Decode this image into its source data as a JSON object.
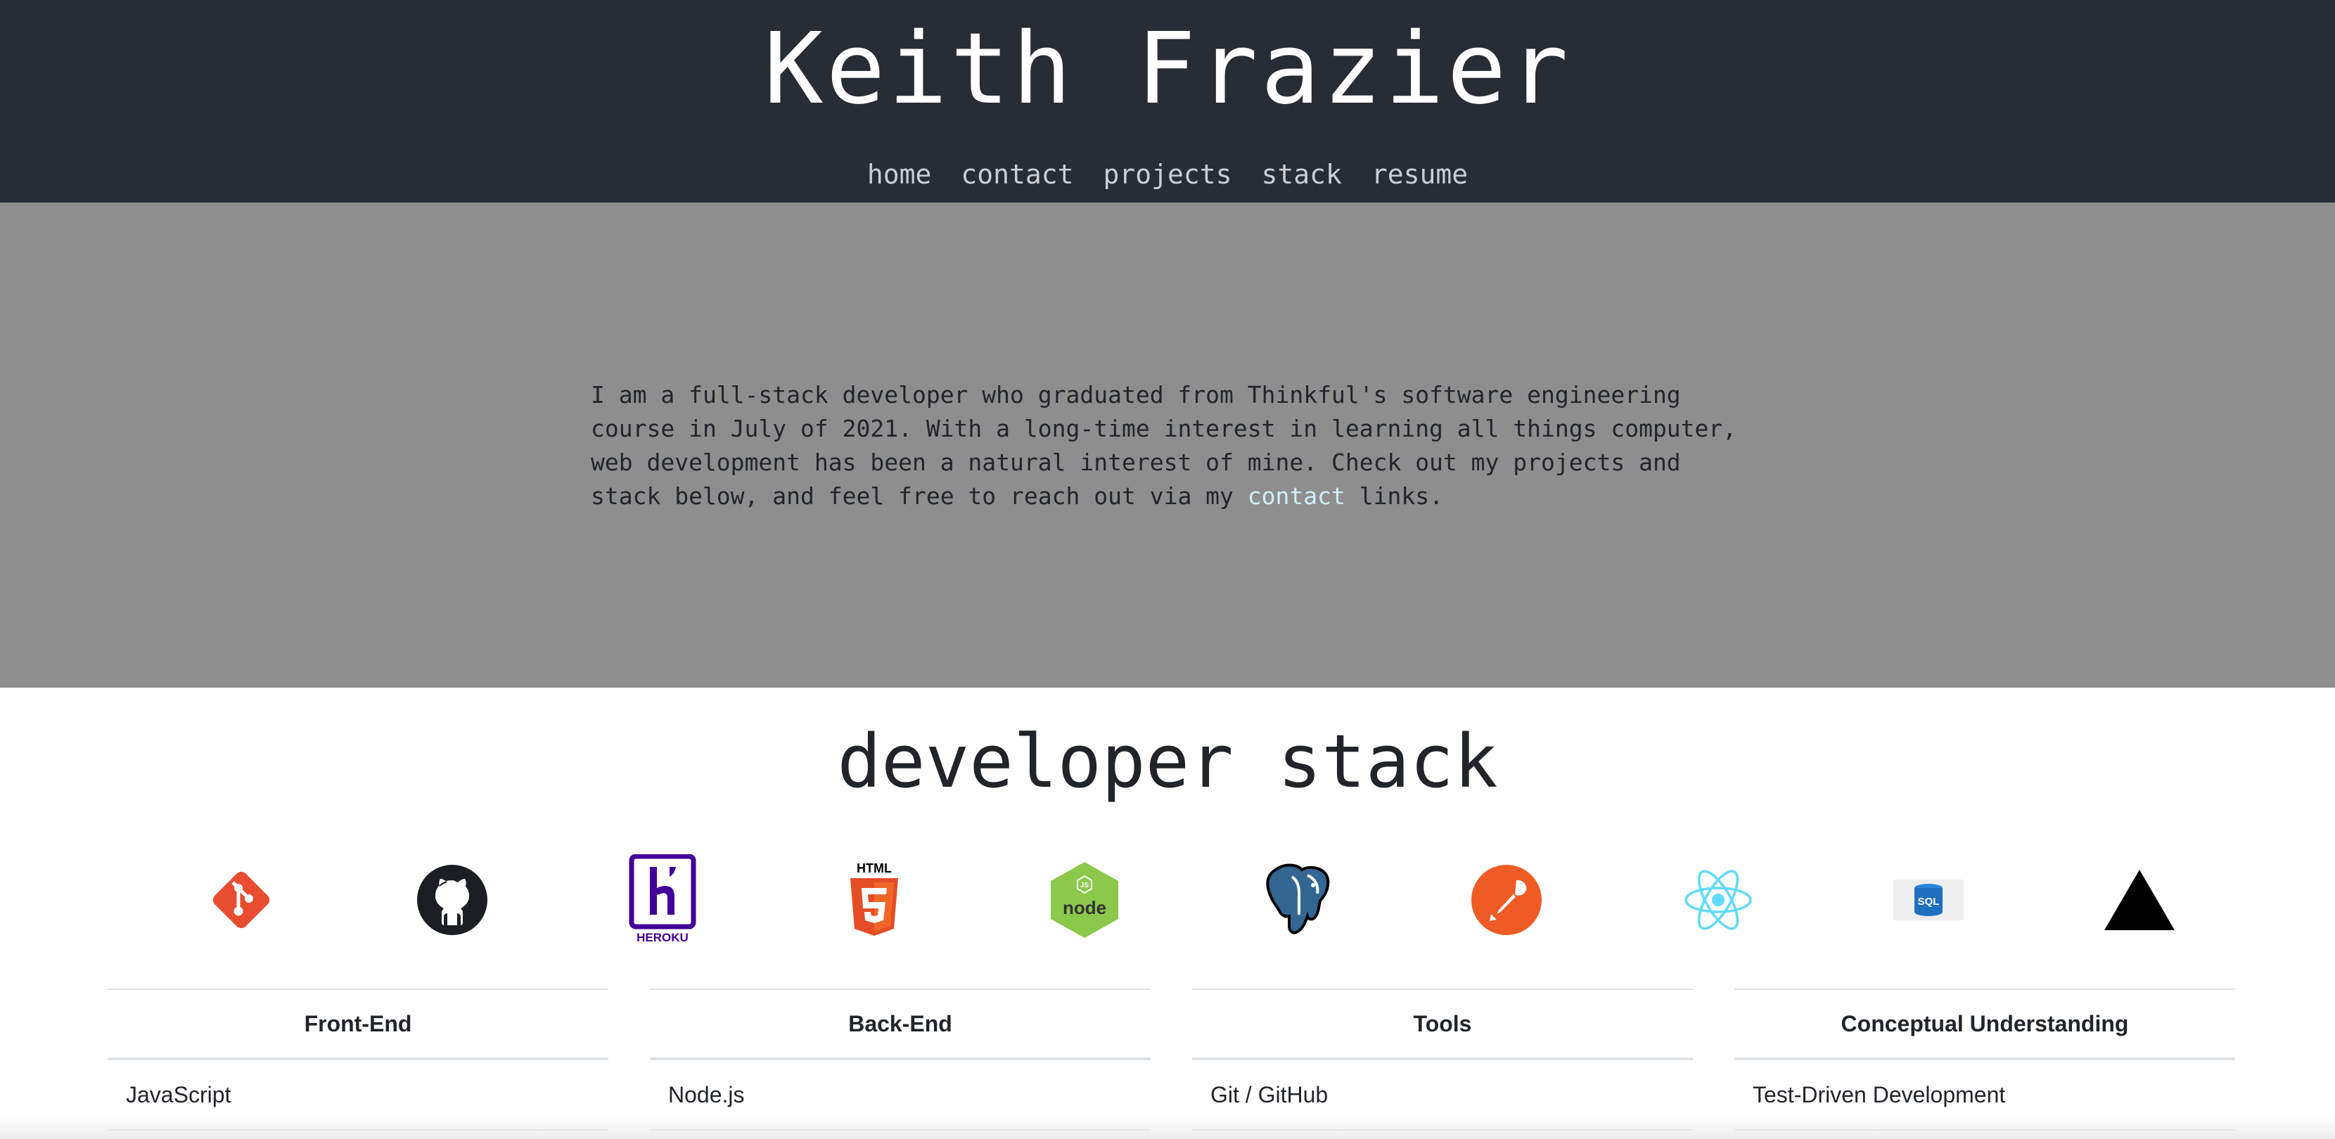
{
  "header": {
    "title": "Keith Frazier",
    "nav": [
      "home",
      "contact",
      "projects",
      "stack",
      "resume"
    ]
  },
  "intro": {
    "text_before_link": "I am a full-stack developer who graduated from Thinkful's software engineering course in July of 2021. With a long-time interest in learning all things computer, web development has been a natural interest of mine. Check out my projects and stack below, and feel free to reach out via my ",
    "link_text": "contact",
    "text_after_link": " links."
  },
  "stack": {
    "heading": "developer stack",
    "icons": [
      "git-icon",
      "github-icon",
      "heroku-icon",
      "html5-icon",
      "nodejs-icon",
      "postgresql-icon",
      "postman-icon",
      "react-icon",
      "sql-icon",
      "vercel-icon"
    ],
    "icon_labels": {
      "html5": "HTML",
      "heroku": "HEROKU",
      "node": "node",
      "sql": "SQL"
    },
    "tables": [
      {
        "header": "Front-End",
        "first_item": "JavaScript"
      },
      {
        "header": "Back-End",
        "first_item": "Node.js"
      },
      {
        "header": "Tools",
        "first_item": "Git / GitHub"
      },
      {
        "header": "Conceptual Understanding",
        "first_item": "Test-Driven Development"
      }
    ]
  },
  "colors": {
    "header_bg": "#282c34",
    "intro_bg": "#8e8e8e",
    "link": "#cfeef6",
    "git": "#e84d31",
    "heroku": "#430098",
    "html5": "#e44d26",
    "node": "#8cc84b",
    "postgres": "#336791",
    "postman": "#ef5b25",
    "react": "#61dafb",
    "sql": "#1f6fbf"
  }
}
